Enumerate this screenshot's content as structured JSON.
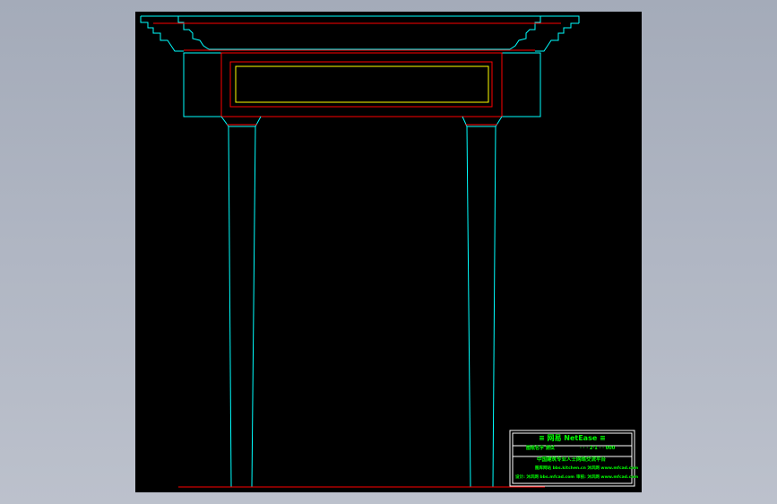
{
  "colors": {
    "background_top": "#a4abb9",
    "viewport": "#000000",
    "cyan_line": "#00ffff",
    "red_line": "#ff0000",
    "yellow_line": "#ffff00",
    "green_text": "#00ff00",
    "white_frame": "#ffffff"
  },
  "title_block": {
    "header": "≡ 网易 NetEase ≡",
    "line2_left": "图纸名字 测试",
    "line2_right": "· · ·  2·1 · ·  000",
    "line3": "中国建筑专业人士网络交流平台",
    "line4": "图库网站 bbs.kitchen.cn  沐风网 www.mfcad.com",
    "line5_left": "设计: 沐风网 bbs.mfcad.com",
    "line5_right": "审核: 沐风网 www.mfcad.com"
  }
}
